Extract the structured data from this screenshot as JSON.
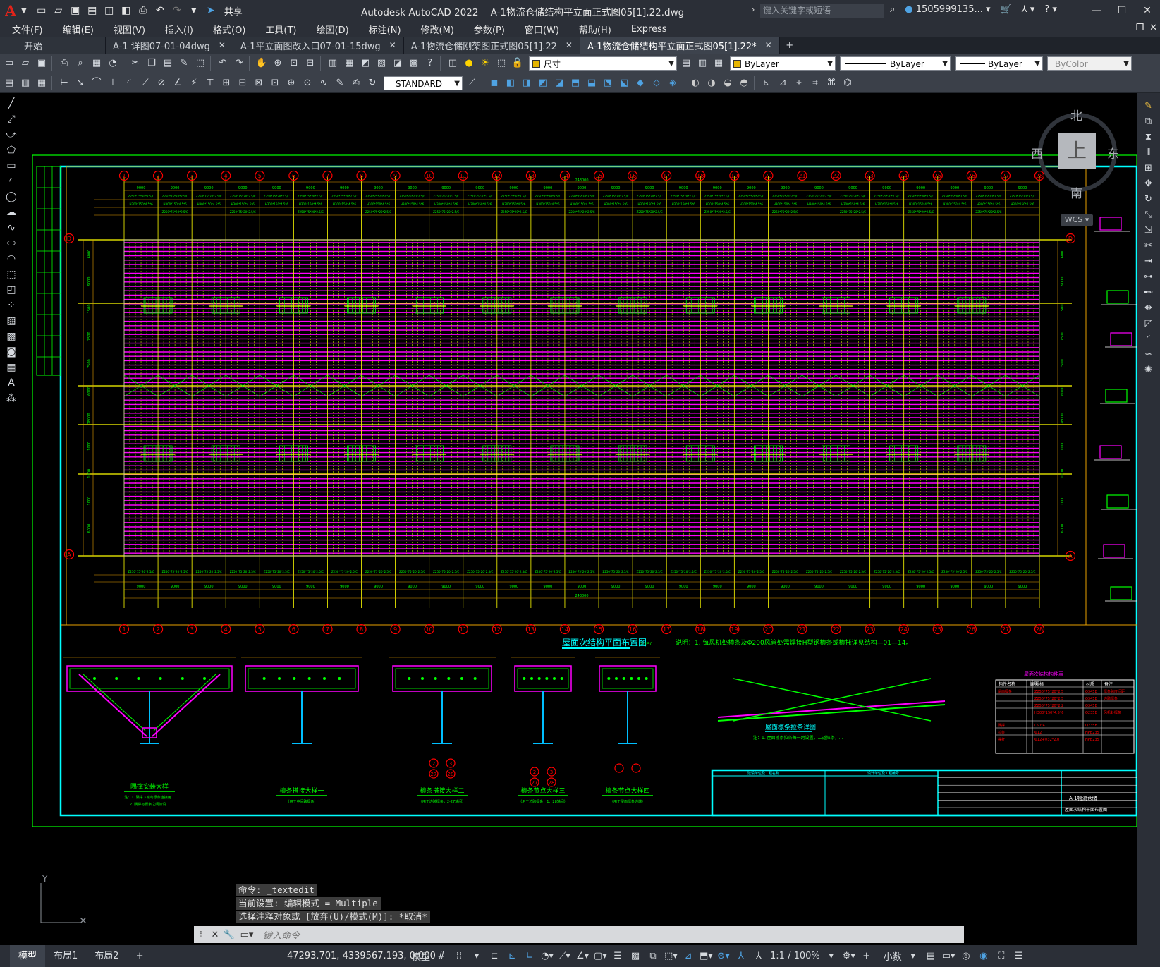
{
  "app": {
    "title": "Autodesk AutoCAD 2022",
    "file": "A-1物流仓储结构平立面正式图05[1].22.dwg",
    "share_label": "共享",
    "search_placeholder": "键入关键字或短语",
    "user": "1505999135...",
    "logo": "A"
  },
  "menu": [
    "文件(F)",
    "编辑(E)",
    "视图(V)",
    "插入(I)",
    "格式(O)",
    "工具(T)",
    "绘图(D)",
    "标注(N)",
    "修改(M)",
    "参数(P)",
    "窗口(W)",
    "帮助(H)",
    "Express"
  ],
  "tabs": [
    {
      "label": "开始",
      "closable": false,
      "active": false
    },
    {
      "label": "A-1 详图07-01-04dwg",
      "closable": true,
      "active": false
    },
    {
      "label": "A-1平立面图改入口07-01-15dwg",
      "closable": true,
      "active": false
    },
    {
      "label": "A-1物流仓储刚架图正式图05[1].22",
      "closable": true,
      "active": false
    },
    {
      "label": "A-1物流仓储结构平立面正式图05[1].22*",
      "closable": true,
      "active": true
    }
  ],
  "toolbar": {
    "layer": "尺寸",
    "color": "ByLayer",
    "linetype": "ByLayer",
    "lineweight": "ByLayer",
    "plotstyle": "ByColor",
    "textstyle": "STANDARD",
    "layer_swatch": "#e5b400"
  },
  "viewcube": {
    "north": "北",
    "south": "南",
    "east": "东",
    "west": "西",
    "top": "上",
    "wcs": "WCS"
  },
  "drawing": {
    "plan_title": "屋面次结构平面布置图",
    "scale_label": "1:150",
    "note": "说明：1. 每风机处檩条及Φ200风管处需焊接H型钢檩条或檩托详见结构—01—14。",
    "total_dim": "243000",
    "bay_dim": "9000",
    "grid_numbers": [
      "1",
      "2",
      "3",
      "4",
      "5",
      "6",
      "7",
      "8",
      "9",
      "10",
      "11",
      "12",
      "13",
      "14",
      "15",
      "16",
      "17",
      "18",
      "19",
      "20",
      "21",
      "22",
      "23",
      "24",
      "25",
      "26",
      "27",
      "28"
    ],
    "grid_letter_top": "D",
    "grid_letter_bottom": "A",
    "details": [
      {
        "title": "隅撑安装大样",
        "note1": "注：1. 隅撑下端与檩条连接用...",
        "note2": "2. 隅撑与檩条之间加设..."
      },
      {
        "title": "檩条搭接大样一",
        "note1": "（用于中间跨檩条）"
      },
      {
        "title": "檩条搭接大样二",
        "note1": "（用于边跨檩条，2-27轴间）"
      },
      {
        "title": "檩条节点大样三",
        "note1": "（用于边跨檩条，1、28轴间）"
      },
      {
        "title": "檩条节点大样四",
        "note1": "（用于屋面檩条边端）"
      }
    ],
    "detail_markers": [
      [
        "2",
        "3"
      ],
      [
        "27",
        "28"
      ],
      [
        "2",
        "3"
      ],
      [
        "27",
        "28"
      ]
    ],
    "tie_title": "屋面檩条拉条详图",
    "tie_note": "注：1. 屋面檩条拉条每一跨设置，二道拉条，...",
    "table_title": "屋面次结构构件表",
    "table_headers": [
      "构件名称",
      "编号",
      "规格",
      "材质",
      "备注"
    ],
    "table_rows": [
      [
        "屋面檩条",
        "",
        "Z250*75*20*2.5",
        "Q345B",
        "檩条跨度间距"
      ],
      [
        "",
        "",
        "Z250*75*20*2.5",
        "Q345B",
        "边跨檩条"
      ],
      [
        "",
        "",
        "Z250*75*20*2.2",
        "Q345B",
        ""
      ],
      [
        "",
        "",
        "H300*150*4.5*6",
        "Q235B",
        "风机处檩条"
      ],
      [
        "隅撑",
        "",
        "L50*4",
        "Q235B",
        ""
      ],
      [
        "拉条",
        "",
        "Φ12",
        "HPB235",
        ""
      ],
      [
        "撑杆",
        "",
        "Φ12+Φ32*2.0",
        "HPB235",
        ""
      ]
    ],
    "titleblock": {
      "project": "A-1物流仓储",
      "drawing": "屋面次结构平面布置图",
      "col1": "建设单位及工程名称",
      "col2": "设计单位及工程编号"
    },
    "left_dims": [
      "6000",
      "9000",
      "1500",
      "7500",
      "7500",
      "6000",
      "28000",
      "1000",
      "1000",
      "1000",
      "6000"
    ],
    "purlin_label": "Z250*75*20*2.5/C",
    "h_label": "H300*150*4.5*6"
  },
  "command": {
    "history": [
      "命令: _textedit",
      "当前设置: 编辑模式 = Multiple",
      "选择注释对象或 [放弃(U)/模式(M)]: *取消*"
    ],
    "placeholder": "键入命令"
  },
  "status": {
    "layouts": [
      "模型",
      "布局1",
      "布局2"
    ],
    "coords": "47293.701, 4339567.193, 0.000",
    "mode": "模型",
    "scale": "1:1 / 100%",
    "units": "小数"
  },
  "colors": {
    "border": "#00ffff",
    "frame": "#00ff00",
    "purlin": "#ff00ff",
    "grid": "#ffff00",
    "bubble": "#ff0000",
    "dim": "#e8a000"
  }
}
